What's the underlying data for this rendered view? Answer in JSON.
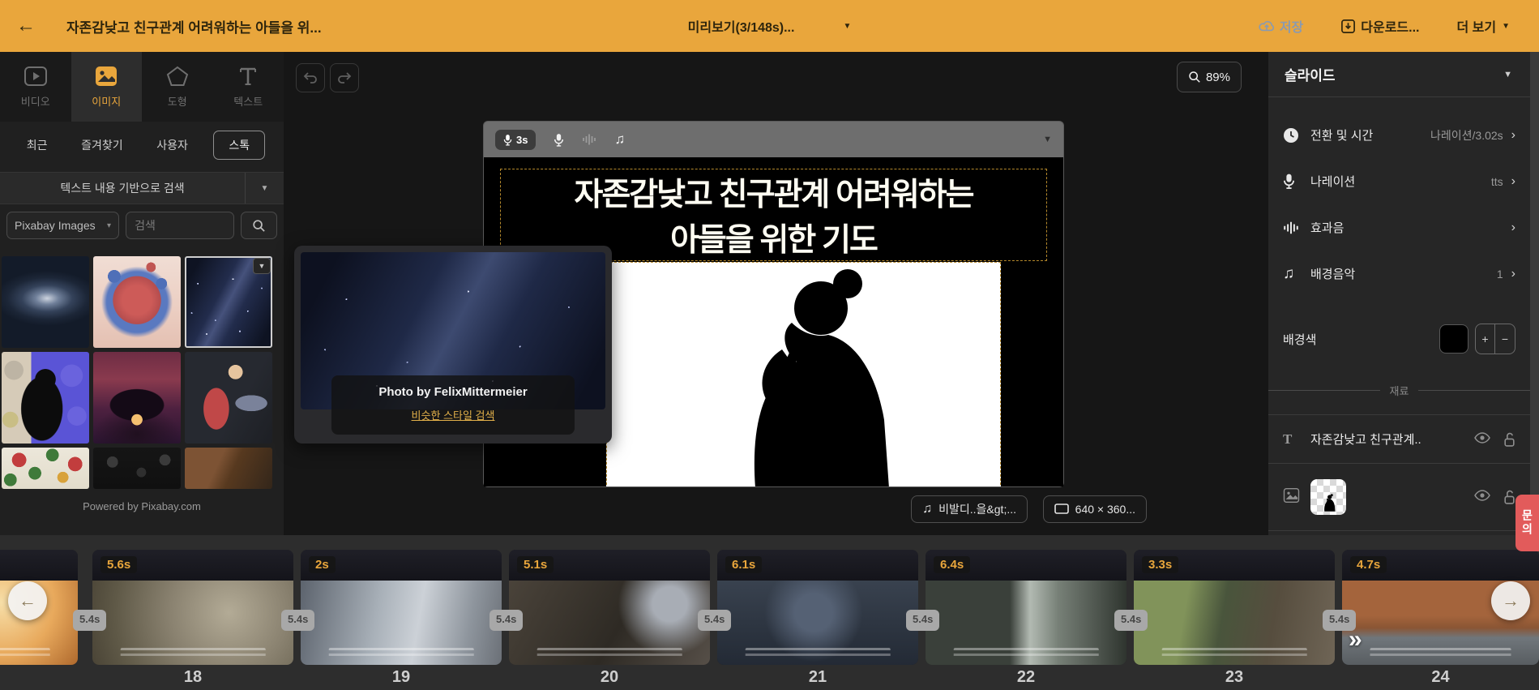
{
  "colors": {
    "accent": "#E9A63C",
    "contact_badge": "#E25B5B",
    "background_swatch": "#000000"
  },
  "topbar": {
    "title": "자존감낮고 친구관계 어려워하는 아들을 위...",
    "preview_label": "미리보기(3/148s)...",
    "save_label": "저장",
    "download_label": "다운로드...",
    "more_label": "더 보기"
  },
  "left_panel": {
    "tabs": [
      {
        "label": "비디오"
      },
      {
        "label": "이미지"
      },
      {
        "label": "도형"
      },
      {
        "label": "텍스트"
      }
    ],
    "sub_tabs": [
      {
        "label": "최근"
      },
      {
        "label": "즐겨찾기"
      },
      {
        "label": "사용자"
      },
      {
        "label": "스톡"
      }
    ],
    "search_mode_label": "텍스트 내용 기반으로 검색",
    "provider_select": "Pixabay Images",
    "search_placeholder": "검색",
    "powered_by": "Powered by Pixabay.com"
  },
  "canvas": {
    "zoom_level": "89%",
    "slide_toolbar": {
      "narration_chip": "3s"
    },
    "slide": {
      "title_line1": "자존감낮고 친구관계 어려워하는",
      "title_line2": "아들을 위한 기도"
    },
    "photo_card": {
      "credit": "Photo by FelixMittermeier",
      "link": "비슷한 스타일 검색"
    },
    "music_chip": "비발디..을&gt;...",
    "size_chip": "640 × 360..."
  },
  "right_sidebar": {
    "title": "슬라이드",
    "rows": [
      {
        "label": "전환 및 시간",
        "value": "나레이션/3.02s"
      },
      {
        "label": "나레이션",
        "value": "tts"
      },
      {
        "label": "효과음",
        "value": ""
      },
      {
        "label": "배경음악",
        "value": "1"
      }
    ],
    "background_color_label": "배경색",
    "plus_label": "+",
    "minus_label": "−",
    "materials_divider": "재료",
    "materials": [
      {
        "type_glyph": "T",
        "label": "자존감낮고 친구관계.."
      }
    ]
  },
  "timeline": {
    "transition_duration": "5.4s",
    "slides": [
      {
        "number": "18",
        "duration": "5.6s"
      },
      {
        "number": "19",
        "duration": "2s"
      },
      {
        "number": "20",
        "duration": "5.1s"
      },
      {
        "number": "21",
        "duration": "6.1s"
      },
      {
        "number": "22",
        "duration": "6.4s"
      },
      {
        "number": "23",
        "duration": "3.3s"
      },
      {
        "number": "24",
        "duration": "4.7s"
      }
    ]
  },
  "contact_badge": "문의"
}
